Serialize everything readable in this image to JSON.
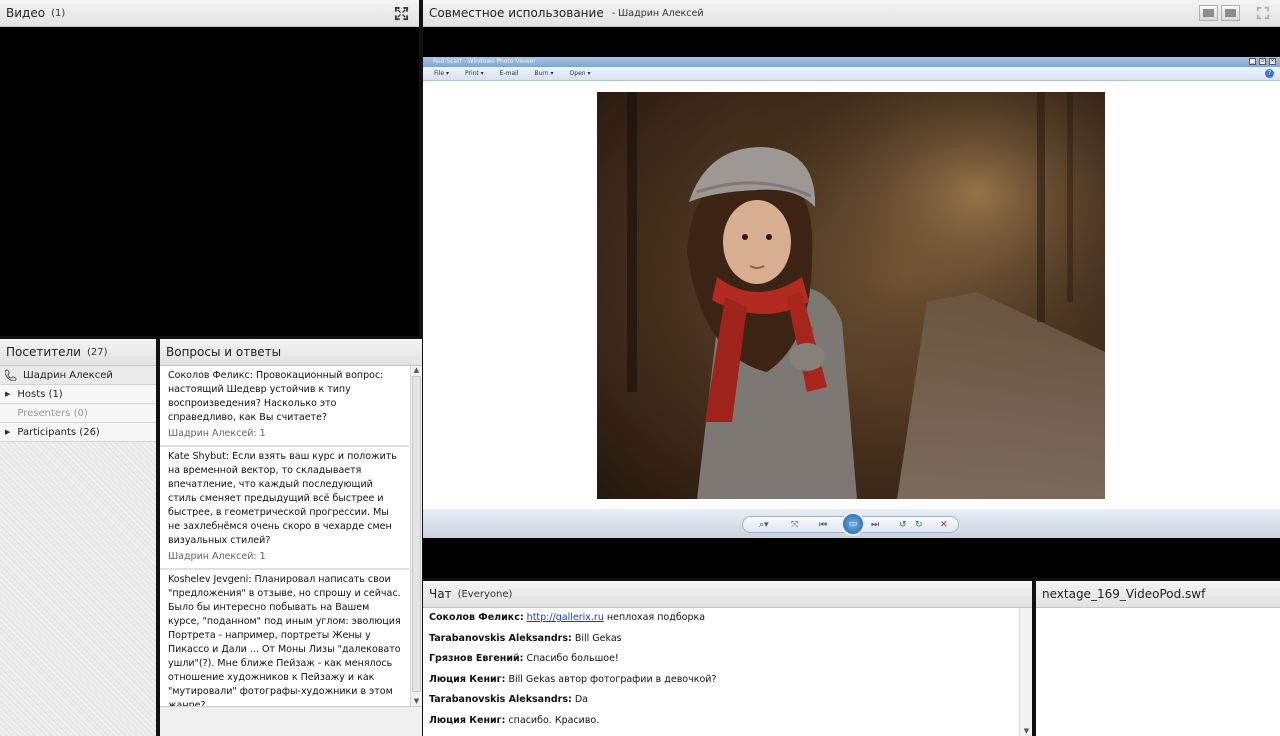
{
  "video_pod": {
    "title": "Видео",
    "count": "(1)"
  },
  "share_pod": {
    "title": "Совместное использование",
    "presenter": "- Шадрин Алексей",
    "viewer": {
      "window_title": "Red Scarf - Windows Photo Viewer",
      "menu": [
        "File ▾",
        "Print ▾",
        "E-mail",
        "Burn ▾",
        "Open ▾"
      ],
      "help": "?"
    }
  },
  "attendees_pod": {
    "title": "Посетители",
    "count": "(27)",
    "presenter_name": "Шадрин Алексей",
    "groups": [
      {
        "label": "Hosts (1)",
        "dim": false
      },
      {
        "label": "Presenters (0)",
        "dim": true
      },
      {
        "label": "Participants (26)",
        "dim": false
      }
    ]
  },
  "qa_pod": {
    "title": "Вопросы и ответы",
    "items": [
      {
        "text": "Соколов Феликс: Провокационный вопрос: настоящий Шедевр устойчив к типу воспроизведения? Насколько это справедливо, как Вы считаете?",
        "answer": "Шадрин Алексей: 1"
      },
      {
        "text": "Kate Shybut: Если взять ваш курс и положить на временной вектор, то складываетя впечатление, что каждый последующий стиль сменяет предыдущий всё быстрее и быстрее, в геометрической прогрессии. Мы не захлебнёмся очень скоро в чехарде смен визуальных стилей?",
        "answer": "Шадрин Алексей: 1"
      },
      {
        "text": "Koshelev Jevgeni: Планировал написать свои \"предложения\" в отзыве, но спрошу и сейчас. Было бы интересно побывать на Вашем курсе, \"поданном\" под иным углом: эволюция Портрета - например, портреты Жены у Пикассо и Дали ... От Моны Лизы \"далековато ушли\"(?). Мне ближе Пейзаж - как менялось отношение художников к Пейзажу и как \"мутировали\" фотографы-художники в этом жанре?",
        "answer": ""
      }
    ]
  },
  "chat_pod": {
    "title": "Чат",
    "audience": "(Everyone)",
    "messages": [
      {
        "name": "Соколов Феликс:",
        "link": "http://gallerix.ru",
        "text": " неплохая подборка"
      },
      {
        "name": "Tarabanovskis Aleksandrs:",
        "link": "",
        "text": " Bill Gekas"
      },
      {
        "name": "Грязнов Евгений:",
        "link": "",
        "text": " Спасибо большое!"
      },
      {
        "name": "Люция Кениг:",
        "link": "",
        "text": " Bill Gekas автор фотографии в девочкой?"
      },
      {
        "name": "Tarabanovskis Aleksandrs:",
        "link": "",
        "text": " Da"
      },
      {
        "name": "Люция Кениг:",
        "link": "",
        "text": " спасибо. Красиво."
      }
    ]
  },
  "swf_pod": {
    "title": "nextage_169_VideoPod.swf"
  }
}
